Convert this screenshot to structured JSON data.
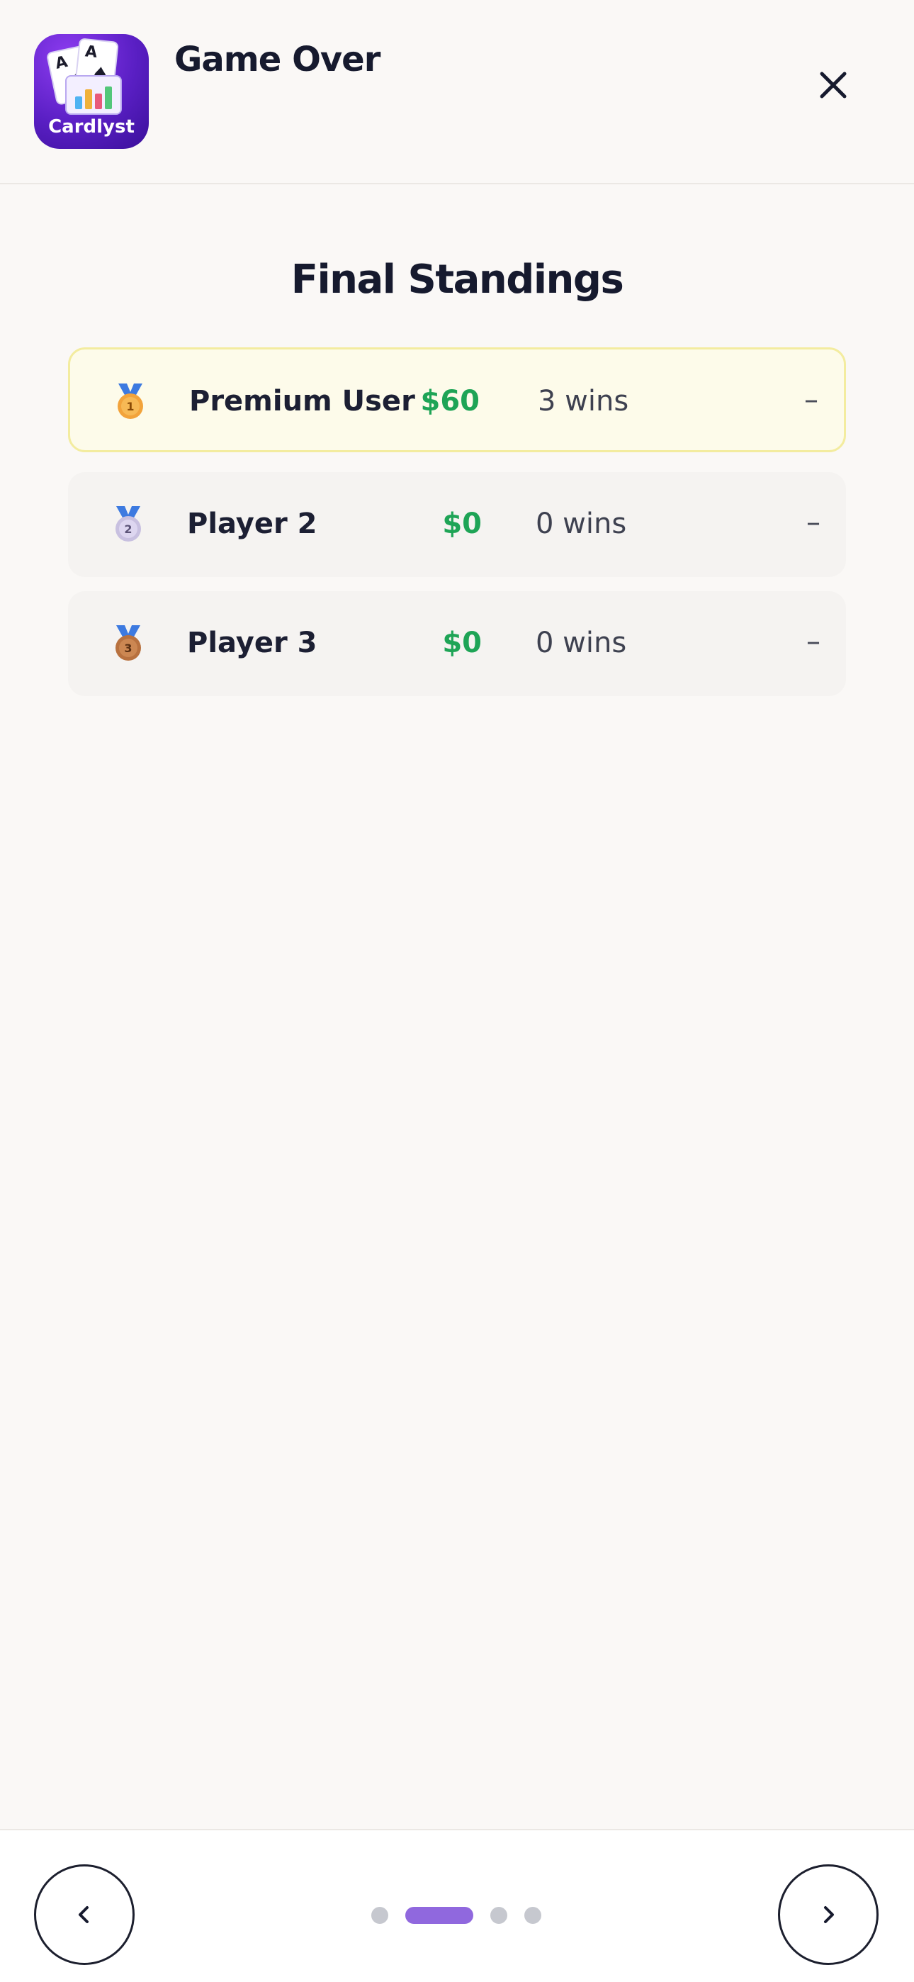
{
  "header": {
    "app_logo_text": "Cardlyst",
    "title": "Game Over",
    "close_icon": "close-icon"
  },
  "main": {
    "section_title": "Final Standings",
    "standings": [
      {
        "rank": 1,
        "medal_icon": "medal-gold-icon",
        "name": "Premium User",
        "money": "$60",
        "wins": "3 wins",
        "delta": "–"
      },
      {
        "rank": 2,
        "medal_icon": "medal-silver-icon",
        "name": "Player 2",
        "money": "$0",
        "wins": "0 wins",
        "delta": "–"
      },
      {
        "rank": 3,
        "medal_icon": "medal-bronze-icon",
        "name": "Player 3",
        "money": "$0",
        "wins": "0 wins",
        "delta": "–"
      }
    ]
  },
  "footer": {
    "prev_icon": "chevron-left-icon",
    "next_icon": "chevron-right-icon",
    "page_count": 4,
    "active_page": 2
  },
  "colors": {
    "accent": "#9068de",
    "money": "#1ea456",
    "highlight_bg": "#fdfbea",
    "highlight_border": "#f3ec9f"
  }
}
